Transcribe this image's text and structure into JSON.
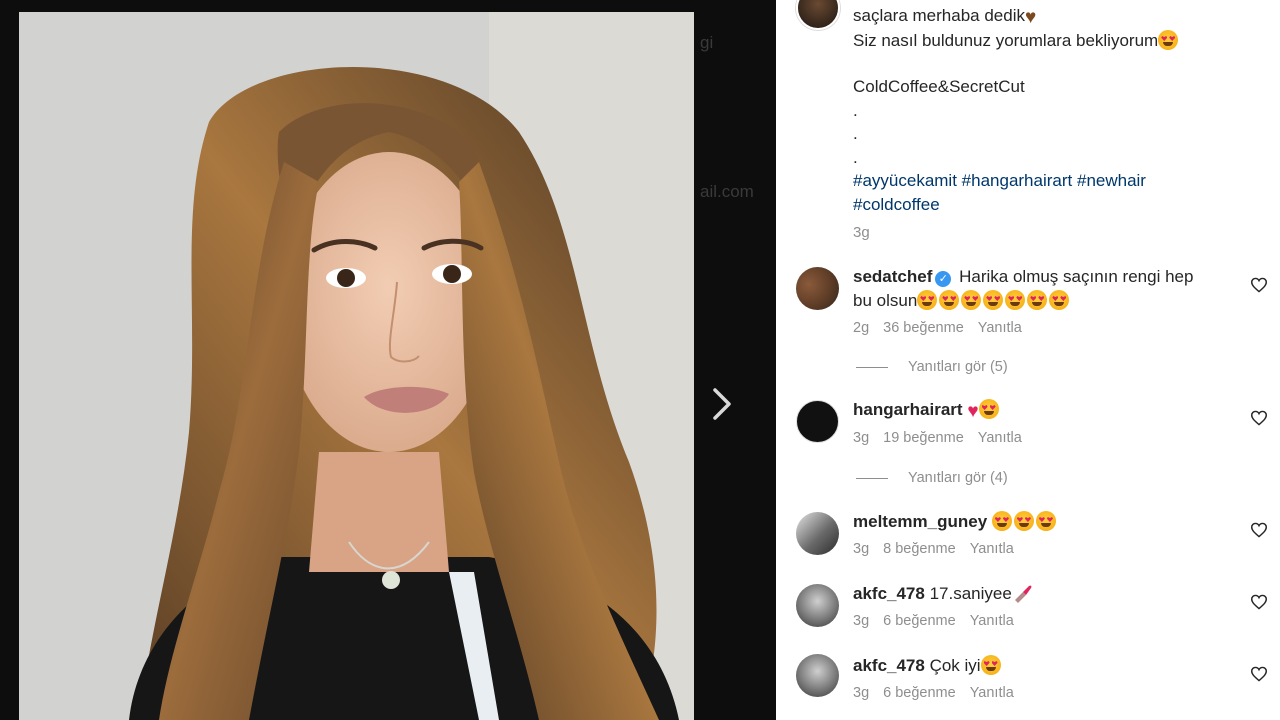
{
  "caption": {
    "lines": [
      "saçlara merhaba dedik",
      "Siz nasıl buldunuz yorumlara bekliyorum",
      "ColdCoffee&SecretCut",
      ".",
      ".",
      "."
    ],
    "hashtags_line1": [
      "#ayyücekamit",
      "#hangarhairart",
      "#newhair"
    ],
    "hashtags_line2": [
      "#coldcoffee"
    ],
    "time": "3g"
  },
  "comments": [
    {
      "user": "sedatchef",
      "verified": true,
      "text_line1": "Harika olmuş saçının rengi hep",
      "text_line2": "bu olsun",
      "emojis": 7,
      "time": "2g",
      "likes": "36 beğenme",
      "reply": "Yanıtla",
      "view_replies": "Yanıtları gör (5)"
    },
    {
      "user": "hangarhairart",
      "text": "",
      "time": "3g",
      "likes": "19 beğenme",
      "reply": "Yanıtla",
      "view_replies": "Yanıtları gör (4)"
    },
    {
      "user": "meltemm_guney",
      "text": "",
      "emojis": 3,
      "time": "3g",
      "likes": "8 beğenme",
      "reply": "Yanıtla"
    },
    {
      "user": "akfc_478",
      "text": "17.saniyee",
      "time": "3g",
      "likes": "6 beğenme",
      "reply": "Yanıtla"
    },
    {
      "user": "akfc_478",
      "text": "Çok iyi",
      "time": "3g",
      "likes": "6 beğenme",
      "reply": "Yanıtla"
    }
  ],
  "backdrop": {
    "ghost_1": "gi",
    "ghost_2": "ail.com"
  },
  "colors": {
    "link": "#00376b",
    "muted": "#8e8e8e",
    "text": "#262626",
    "like_red": "#e0245e"
  },
  "icons": {
    "next": "chevron-right-icon",
    "like": "heart-outline-icon",
    "verified": "verified-badge-icon"
  }
}
